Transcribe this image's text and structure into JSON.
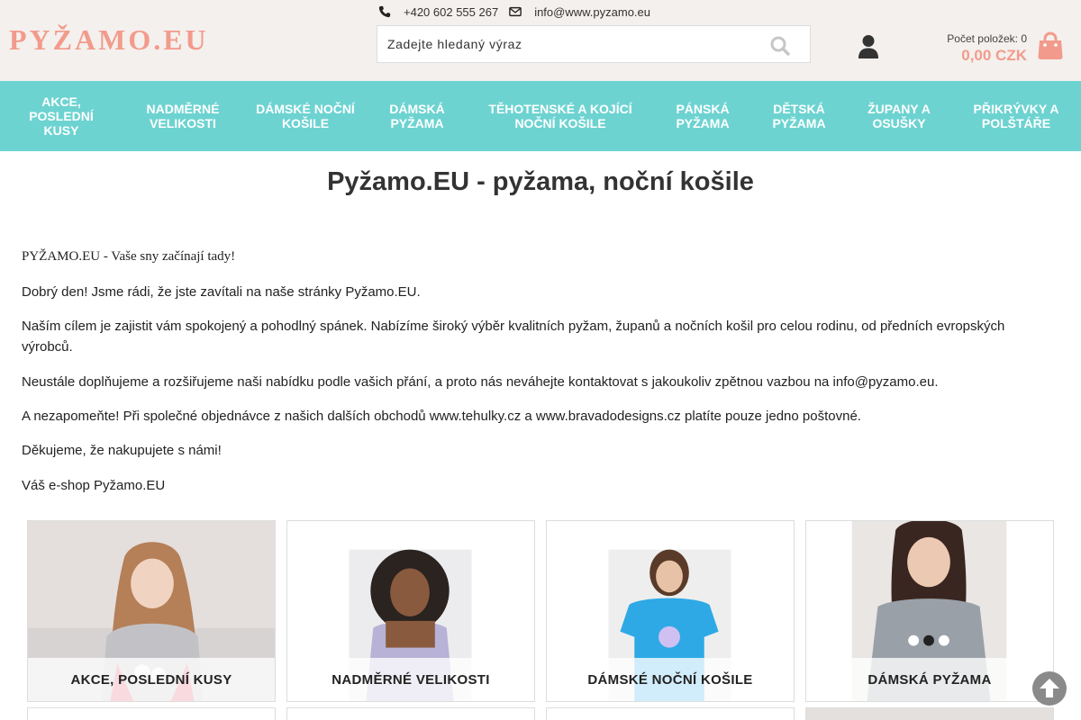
{
  "header": {
    "logo_text": "PYŽAMO.EU",
    "phone": "+420 602 555 267",
    "email": "info@www.pyzamo.eu",
    "search_placeholder": "Zadejte hledaný výraz",
    "cart_count": "Počet položek: 0",
    "cart_total": "0,00 CZK",
    "accent_color": "#f29b8c"
  },
  "nav": {
    "background": "#6dd3d1",
    "items": [
      {
        "label": "AKCE, POSLEDNÍ KUSY"
      },
      {
        "label": "NADMĚRNÉ VELIKOSTI"
      },
      {
        "label": "DÁMSKÉ NOČNÍ KOŠILE"
      },
      {
        "label": "DÁMSKÁ PYŽAMA"
      },
      {
        "label": "TĚHOTENSKÉ A KOJÍCÍ NOČNÍ KOŠILE"
      },
      {
        "label": "PÁNSKÁ PYŽAMA"
      },
      {
        "label": "DĚTSKÁ PYŽAMA"
      },
      {
        "label": "ŽUPANY A OSUŠKY"
      },
      {
        "label": "PŘIKRÝVKY A POLŠTÁŘE"
      }
    ]
  },
  "main": {
    "title": "Pyžamo.EU - pyžama, noční košile",
    "paragraphs": [
      "PYŽAMO.EU - Vaše sny začínají tady!",
      "Dobrý den! Jsme rádi, že jste zavítali na naše stránky Pyžamo.EU.",
      "Naším cílem je zajistit vám spokojený a pohodlný spánek. Nabízíme široký výběr kvalitních pyžam, županů a nočních košil pro celou rodinu, od předních evropských výrobců.",
      "Neustále doplňujeme a rozšiřujeme naši nabídku podle vašich přání, a proto nás neváhejte kontaktovat s jakoukoliv zpětnou vazbou na info@pyzamo.eu.",
      "A nezapomeňte! Při společné objednávce z našich dalších obchodů www.tehulky.cz a www.bravadodesigns.cz platíte pouze jedno poštovné.",
      "Děkujeme, že nakupujete s námi!",
      "Váš e-shop Pyžamo.EU"
    ]
  },
  "categories": [
    {
      "label": "AKCE, POSLEDNÍ KUSY"
    },
    {
      "label": "NADMĚRNÉ VELIKOSTI"
    },
    {
      "label": "DÁMSKÉ NOČNÍ KOŠILE"
    },
    {
      "label": "DÁMSKÁ PYŽAMA"
    }
  ],
  "icons": {
    "phone": "phone-icon",
    "email": "envelope-icon",
    "search": "search-icon",
    "user": "user-icon",
    "cart": "shopping-bag-icon",
    "back_to_top": "arrow-up-icon"
  }
}
